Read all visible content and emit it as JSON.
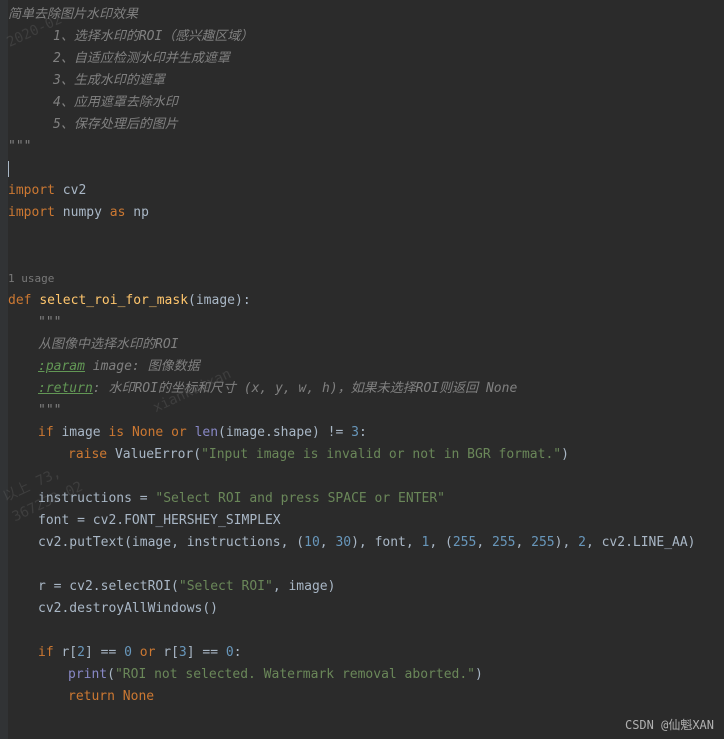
{
  "docstring": {
    "title": "简单去除图片水印效果",
    "step1": "1、选择水印的ROI（感兴趣区域）",
    "step2": "2、自适应检测水印并生成遮罩",
    "step3": "3、生成水印的遮罩",
    "step4": "4、应用遮罩去除水印",
    "step5": "5、保存处理后的图片",
    "close": "\"\"\""
  },
  "imports": {
    "import1_kw": "import ",
    "import1_mod": "cv2",
    "import2_kw": "import ",
    "import2_mod": "numpy ",
    "import2_as": "as ",
    "import2_alias": "np"
  },
  "usage_label": "1 usage",
  "func": {
    "def_kw": "def ",
    "name": "select_roi_for_mask",
    "open_paren": "(",
    "param": "image",
    "close": "):",
    "doc_open": "\"\"\"",
    "doc_desc": "从图像中选择水印的ROI",
    "doc_param_tag": ":param",
    "doc_param_rest": " image: 图像数据",
    "doc_return_tag": ":return",
    "doc_return_rest": ": 水印ROI的坐标和尺寸 (x, y, w, h)，如果未选择ROI则返回 None",
    "doc_close": "\"\"\""
  },
  "code": {
    "if1_kw": "if ",
    "if1_var": "image ",
    "if1_is": "is ",
    "if1_none": "None ",
    "if1_or": "or ",
    "if1_len": "len",
    "if1_lenarg": "(image.shape) != ",
    "if1_num": "3",
    "if1_colon": ":",
    "raise_kw": "raise ",
    "raise_err": "ValueError",
    "raise_open": "(",
    "raise_str": "\"Input image is invalid or not in BGR format.\"",
    "raise_close": ")",
    "instr_var": "instructions = ",
    "instr_str": "\"Select ROI and press SPACE or ENTER\"",
    "font_line": "font = cv2.FONT_HERSHEY_SIMPLEX",
    "put_pre": "cv2.putText(image",
    "put_c1": ", ",
    "put_arg2": "instructions",
    "put_c2": ", ",
    "put_paren_o": "(",
    "put_n1": "10",
    "put_c3": ", ",
    "put_n2": "30",
    "put_paren_c": ")",
    "put_c4": ", ",
    "put_font": "font",
    "put_c5": ", ",
    "put_n3": "1",
    "put_c6": ", ",
    "put_paren_o2": "(",
    "put_255a": "255",
    "put_c7": ", ",
    "put_255b": "255",
    "put_c8": ", ",
    "put_255c": "255",
    "put_paren_c2": ")",
    "put_c9": ", ",
    "put_n4": "2",
    "put_c10": ", ",
    "put_end": "cv2.LINE_AA)",
    "roi_pre": "r = cv2.selectROI(",
    "roi_str": "\"Select ROI\"",
    "roi_post": ", image)",
    "destroy": "cv2.destroyAllWindows()",
    "if2_kw": "if ",
    "if2_r1": "r[",
    "if2_i2": "2",
    "if2_eq1": "] == ",
    "if2_n0a": "0",
    "if2_space": " ",
    "if2_or": "or ",
    "if2_r2": "r[",
    "if2_i3": "3",
    "if2_eq2": "] == ",
    "if2_n0b": "0",
    "if2_colon": ":",
    "print_fn": "print",
    "print_open": "(",
    "print_str": "\"ROI not selected. Watermark removal aborted.\"",
    "print_close": ")",
    "return_kw": "return ",
    "return_none": "None"
  },
  "watermarks": {
    "wm_small1": "2020-02",
    "wm_small2": "xiankuixan",
    "wm_small3": "以上 73,",
    "wm_small4": "367230-02",
    "footer": "CSDN @仙魁XAN"
  }
}
